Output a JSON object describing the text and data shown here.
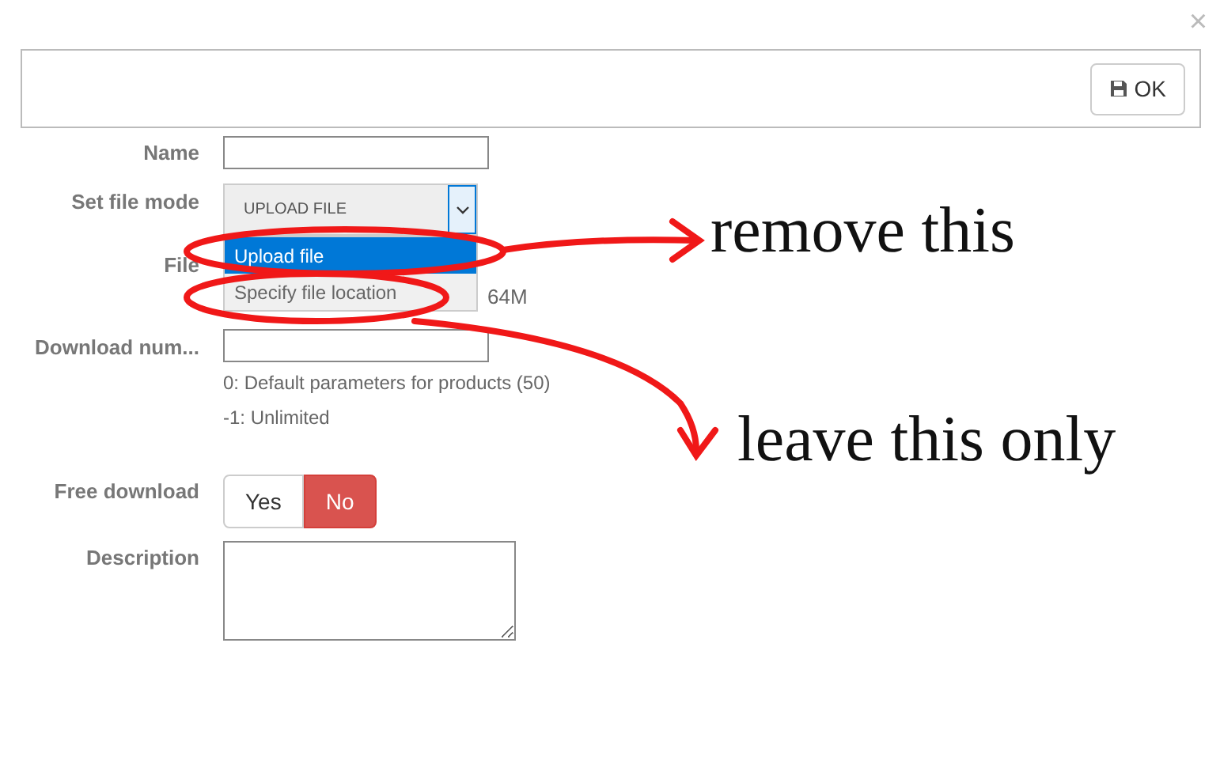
{
  "close": "×",
  "ok_button": {
    "label": "OK"
  },
  "fields": [
    {
      "kind": "text",
      "label": "Name"
    },
    {
      "kind": "select",
      "label": "Set file mode",
      "value": "UPLOAD FILE",
      "expanded": true,
      "options": [
        {
          "label": "Upload file",
          "selected": true
        },
        {
          "label": "Specify file location",
          "selected": false
        }
      ]
    },
    {
      "kind": "file",
      "label": "File",
      "note": "64M"
    },
    {
      "kind": "number",
      "label": "Download num...",
      "help": [
        "0: Default parameters for products (50)",
        "-1: Unlimited"
      ]
    },
    {
      "kind": "toggle",
      "label": "Free download",
      "options": [
        {
          "label": "Yes",
          "selected": false
        },
        {
          "label": "No",
          "selected": true
        }
      ]
    },
    {
      "kind": "textarea",
      "label": "Description"
    }
  ],
  "annotations": [
    {
      "text": "remove this"
    },
    {
      "text": "leave this only"
    }
  ]
}
